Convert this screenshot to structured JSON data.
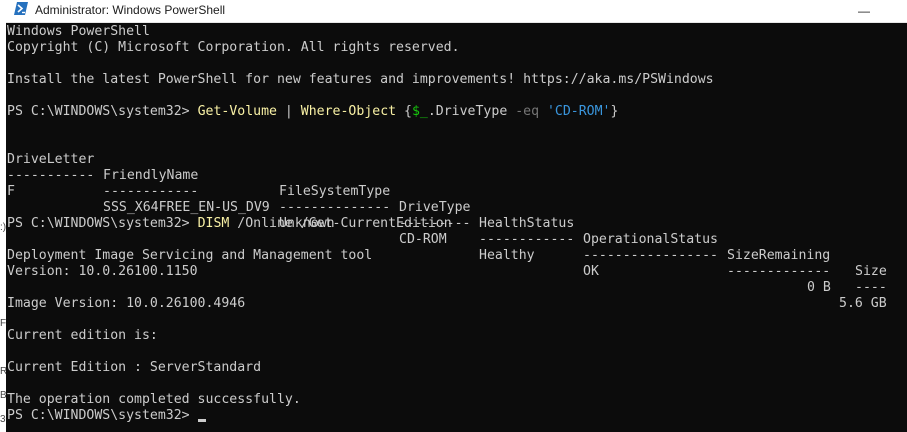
{
  "window": {
    "title": "Administrator: Windows PowerShell",
    "minimize_glyph": "—"
  },
  "left_strip_chars": [
    ":)",
    "F",
    "R",
    "B",
    "30"
  ],
  "console": {
    "banner_1": "Windows PowerShell",
    "banner_2": "Copyright (C) Microsoft Corporation. All rights reserved.",
    "banner_3": "Install the latest PowerShell for new features and improvements! https://aka.ms/PSWindows",
    "prompt": "PS C:\\WINDOWS\\system32> ",
    "cmd1": {
      "verb": "Get-Volume",
      "pipe": " | ",
      "where": "Where-Object",
      "open": " {",
      "var": "$_",
      "prop": ".DriveType",
      "op": " -eq ",
      "str": "'CD-ROM'",
      "close": "}"
    },
    "table": {
      "headers": [
        "DriveLetter",
        "FriendlyName",
        "FileSystemType",
        "DriveType",
        "HealthStatus",
        "OperationalStatus",
        "SizeRemaining",
        "Size"
      ],
      "dashes": [
        "-----------",
        "------------",
        "--------------",
        "---------",
        "------------",
        "-----------------",
        "-------------",
        "----"
      ],
      "row": [
        "F",
        "SSS_X64FREE_EN-US_DV9",
        "Unknown",
        "CD-ROM",
        "Healthy",
        "OK",
        "0 B",
        "5.6 GB"
      ]
    },
    "cmd2": {
      "verb": "DISM",
      "args": " /Online /Get-CurrentEdition"
    },
    "dism_1": "Deployment Image Servicing and Management tool",
    "dism_2": "Version: 10.0.26100.1150",
    "dism_3": "Image Version: 10.0.26100.4946",
    "dism_4": "Current edition is:",
    "dism_5": "Current Edition : ServerStandard",
    "dism_6": "The operation completed successfully."
  }
}
